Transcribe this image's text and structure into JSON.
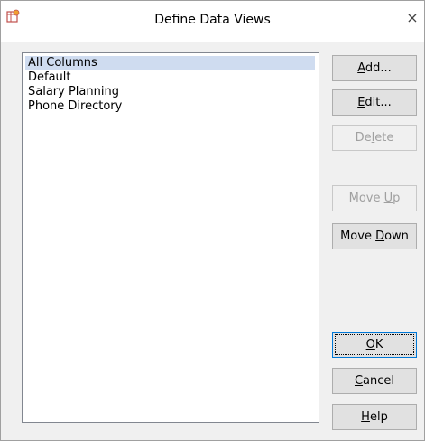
{
  "window": {
    "title": "Define Data Views",
    "close_glyph": "×",
    "icon": "app-icon"
  },
  "list": {
    "items": [
      {
        "label": "All Columns",
        "selected": true
      },
      {
        "label": "Default",
        "selected": false
      },
      {
        "label": "Salary Planning",
        "selected": false
      },
      {
        "label": "Phone Directory",
        "selected": false
      }
    ]
  },
  "buttons": {
    "add": {
      "pre": "",
      "key": "A",
      "post": "dd...",
      "enabled": true
    },
    "edit": {
      "pre": "",
      "key": "E",
      "post": "dit...",
      "enabled": true
    },
    "delete": {
      "pre": "De",
      "key": "l",
      "post": "ete",
      "enabled": false
    },
    "move_up": {
      "pre": "Move ",
      "key": "U",
      "post": "p",
      "enabled": false
    },
    "move_down": {
      "pre": "Move ",
      "key": "D",
      "post": "own",
      "enabled": true
    },
    "ok": {
      "pre": "",
      "key": "O",
      "post": "K",
      "enabled": true
    },
    "cancel": {
      "pre": "",
      "key": "C",
      "post": "ancel",
      "enabled": true
    },
    "help": {
      "pre": "",
      "key": "H",
      "post": "elp",
      "enabled": true
    }
  }
}
